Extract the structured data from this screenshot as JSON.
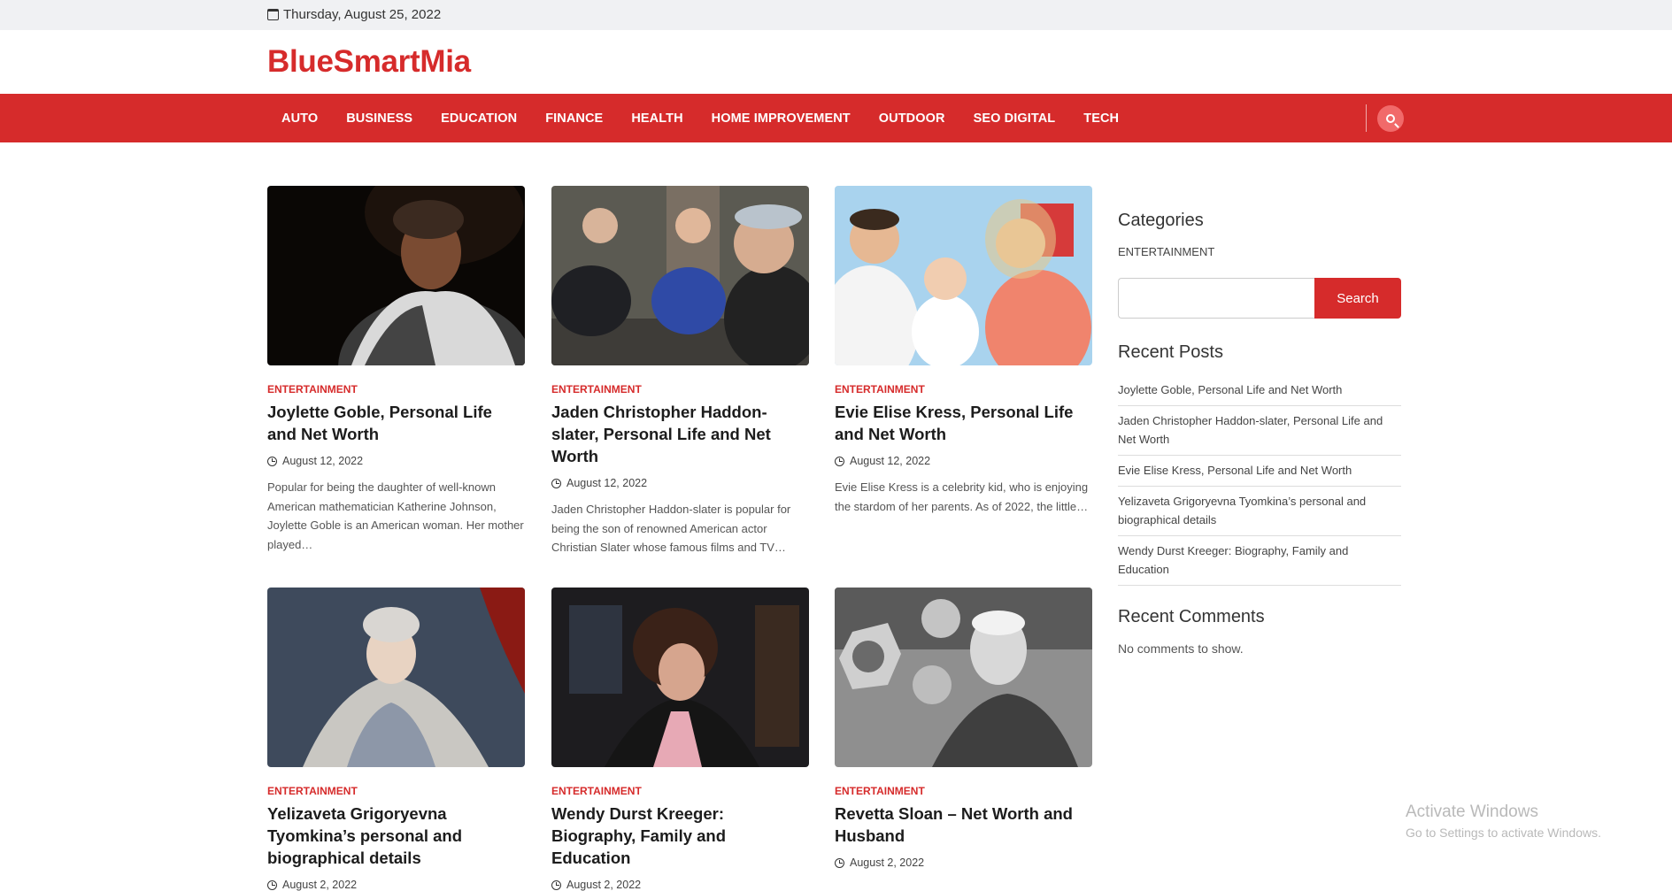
{
  "topbar": {
    "date": "Thursday, August 25, 2022",
    "icon": "calendar-icon"
  },
  "site": {
    "title": "BlueSmartMia",
    "accent": "#d62b2b"
  },
  "nav": {
    "items": [
      "AUTO",
      "BUSINESS",
      "EDUCATION",
      "FINANCE",
      "HEALTH",
      "HOME IMPROVEMENT",
      "OUTDOOR",
      "SEO DIGITAL",
      "TECH"
    ],
    "search_icon": "search-icon"
  },
  "articles": [
    {
      "category": "ENTERTAINMENT",
      "title": "Joylette Goble, Personal Life and Net Worth",
      "date": "August 12, 2022",
      "excerpt": "Popular for being the daughter of well-known American mathematician Katherine Johnson, Joylette Goble is an American woman. Her mother played…"
    },
    {
      "category": "ENTERTAINMENT",
      "title": "Jaden Christopher Haddon-slater, Personal Life and Net Worth",
      "date": "August 12, 2022",
      "excerpt": "Jaden Christopher Haddon-slater is popular for being the son of renowned American actor Christian Slater whose famous films and TV…"
    },
    {
      "category": "ENTERTAINMENT",
      "title": "Evie Elise Kress, Personal Life and Net Worth",
      "date": "August 12, 2022",
      "excerpt": "Evie Elise Kress is a celebrity kid, who is enjoying the stardom of her parents. As of 2022, the little…"
    },
    {
      "category": "ENTERTAINMENT",
      "title": "Yelizaveta Grigoryevna Tyomkina’s personal and biographical details",
      "date": "August 2, 2022",
      "excerpt": ""
    },
    {
      "category": "ENTERTAINMENT",
      "title": "Wendy Durst Kreeger: Biography, Family and Education",
      "date": "August 2, 2022",
      "excerpt": ""
    },
    {
      "category": "ENTERTAINMENT",
      "title": "Revetta Sloan – Net Worth and Husband",
      "date": "August 2, 2022",
      "excerpt": ""
    }
  ],
  "sidebar": {
    "categories_title": "Categories",
    "categories": [
      "ENTERTAINMENT"
    ],
    "search_button": "Search",
    "search_placeholder": "",
    "recent_posts_title": "Recent Posts",
    "recent_posts": [
      "Joylette Goble, Personal Life and Net Worth",
      "Jaden Christopher Haddon-slater, Personal Life and Net Worth",
      "Evie Elise Kress, Personal Life and Net Worth",
      "Yelizaveta Grigoryevna Tyomkina’s personal and biographical details",
      "Wendy Durst Kreeger: Biography, Family and Education"
    ],
    "recent_comments_title": "Recent Comments",
    "recent_comments_empty": "No comments to show."
  },
  "watermark": {
    "line1": "Activate Windows",
    "line2": "Go to Settings to activate Windows."
  }
}
